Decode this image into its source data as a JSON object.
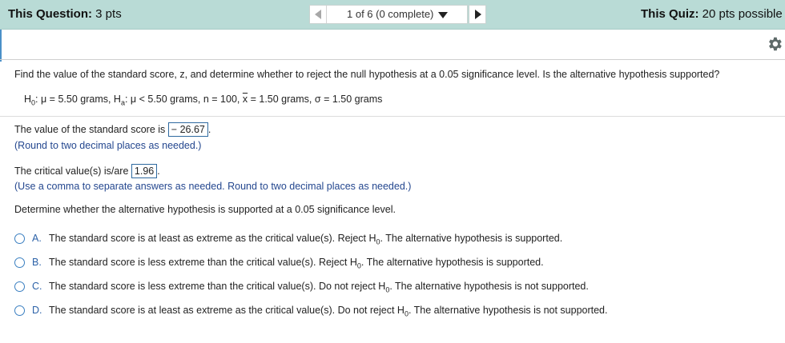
{
  "header": {
    "question_label": "This Question:",
    "question_points": "3 pts",
    "nav_text": "1 of 6 (0 complete)",
    "quiz_label": "This Quiz:",
    "quiz_points": "20 pts possible"
  },
  "question": {
    "prompt": "Find the value of the standard score, z, and determine whether to reject the null hypothesis at a 0.05 significance level. Is the alternative hypothesis supported?",
    "given": {
      "h0": "μ = 5.50 grams,",
      "ha": "μ < 5.50 grams,",
      "n": "n = 100,",
      "xbar_value": "= 1.50 grams,",
      "sigma": "σ = 1.50 grams"
    }
  },
  "part1": {
    "text": "The value of the standard score is",
    "answer": "− 26.67",
    "hint": "(Round to two decimal places as needed.)"
  },
  "part2": {
    "text": "The critical value(s) is/are",
    "answer": "1.96",
    "hint": "(Use a comma to separate answers as needed. Round to two decimal places as needed.)"
  },
  "part3": {
    "text": "Determine whether the alternative hypothesis is supported at a 0.05 significance level."
  },
  "options": [
    {
      "label": "A.",
      "pre": "The standard score is at least as extreme as the critical value(s). Reject H",
      "post": ". The alternative hypothesis is supported."
    },
    {
      "label": "B.",
      "pre": "The standard score is less extreme than the critical value(s). Reject H",
      "post": ". The alternative hypothesis is supported."
    },
    {
      "label": "C.",
      "pre": "The standard score is less extreme than the critical value(s). Do not reject H",
      "post": ". The alternative hypothesis is not supported."
    },
    {
      "label": "D.",
      "pre": "The standard score is at least as extreme as the critical value(s). Do not reject H",
      "post": ". The alternative hypothesis is not supported."
    }
  ],
  "colors": {
    "header_bg": "#b9dbd6",
    "hint": "#24478f",
    "radio": "#3a7fc1"
  }
}
